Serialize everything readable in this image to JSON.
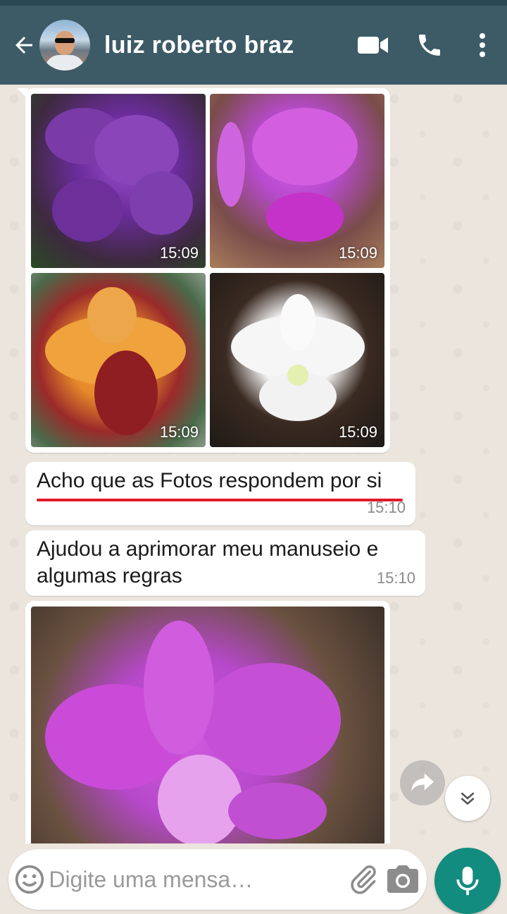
{
  "header": {
    "contact_name": "luiz roberto braz",
    "icons": {
      "back": "back-arrow-icon",
      "video": "video-call-icon",
      "call": "phone-icon",
      "menu": "more-vertical-icon"
    }
  },
  "colors": {
    "header_bg": "#3d5b67",
    "chat_bg": "#ece5dd",
    "accent": "#128c7e",
    "highlight": "#e0192c"
  },
  "album": {
    "photos": [
      {
        "subject": "purple spotted orchids",
        "time": "15:09"
      },
      {
        "subject": "pink cattleya orchid",
        "time": "15:09"
      },
      {
        "subject": "orange and red orchid",
        "time": "15:09"
      },
      {
        "subject": "white orchid",
        "time": "15:09"
      }
    ]
  },
  "messages": [
    {
      "text": "Acho que as Fotos respondem por si",
      "time": "15:10"
    },
    {
      "line1": "Ajudou a aprimorar meu manuseio e",
      "line2": "algumas regras",
      "time": "15:10"
    }
  ],
  "last_photo": {
    "subject": "pink cattleya orchid close-up"
  },
  "composer": {
    "placeholder": "Digite uma mensa…",
    "icons": {
      "emoji": "emoji-icon",
      "attach": "paperclip-icon",
      "camera": "camera-icon",
      "mic": "mic-icon"
    }
  }
}
